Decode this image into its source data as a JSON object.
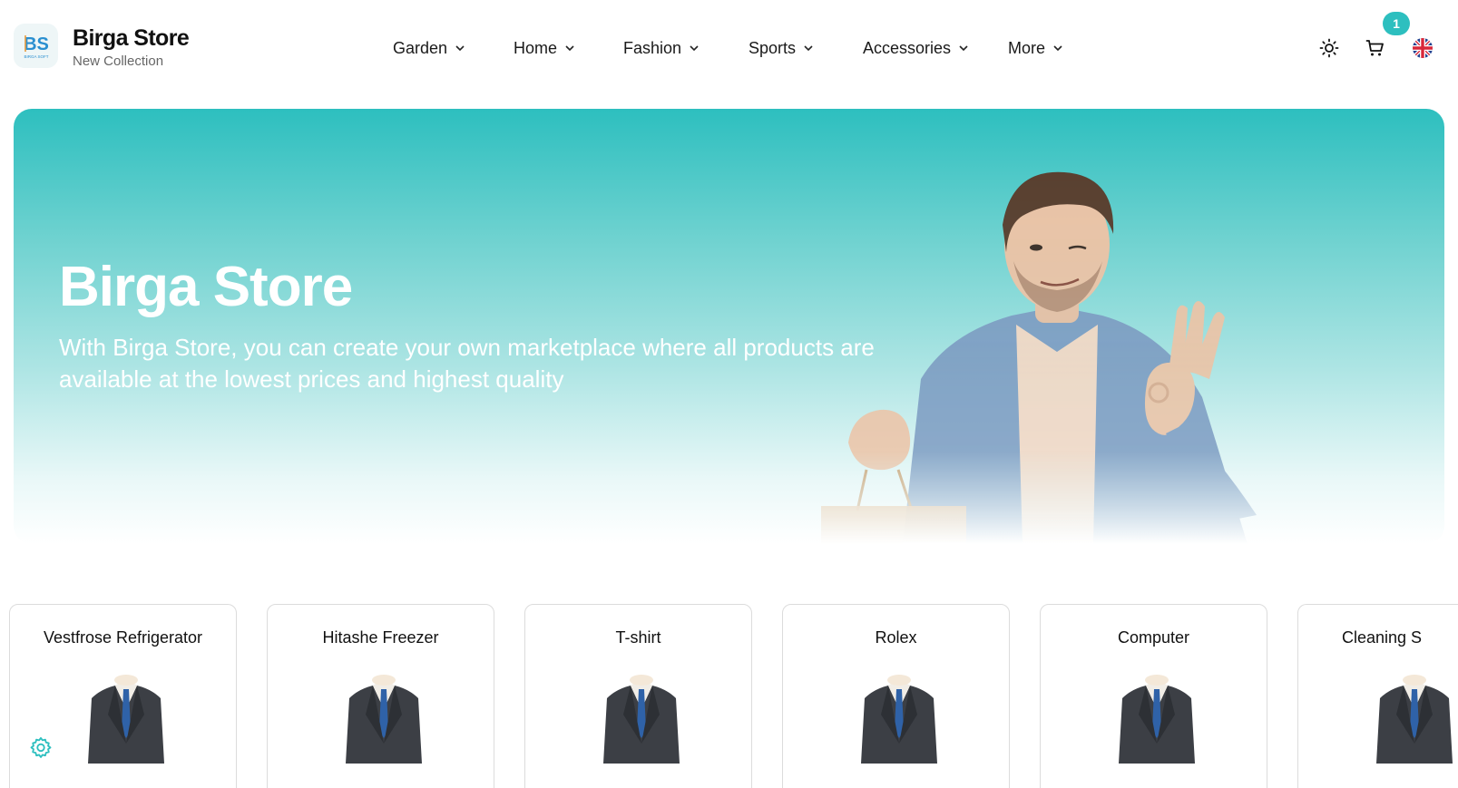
{
  "brand": {
    "title": "Birga Store",
    "subtitle": "New Collection",
    "logo_text": "BS",
    "logo_caption": "BIRGA SOFT"
  },
  "nav": [
    {
      "label": "Garden"
    },
    {
      "label": "Home"
    },
    {
      "label": "Fashion"
    },
    {
      "label": "Sports"
    },
    {
      "label": "Accessories"
    },
    {
      "label": "More"
    }
  ],
  "header_icons": {
    "theme": "sun-icon",
    "cart": "cart-icon",
    "language": "uk-flag-icon"
  },
  "cart_count": "1",
  "hero": {
    "title": "Birga Store",
    "description": "With Birga Store, you can create your own marketplace where all products are available at the lowest prices and highest quality"
  },
  "products": [
    {
      "name": "Vestfrose Refrigerator",
      "icon": "suit-icon"
    },
    {
      "name": "Hitashe Freezer",
      "icon": "suit-icon"
    },
    {
      "name": "T-shirt",
      "icon": "suit-icon"
    },
    {
      "name": "Rolex",
      "icon": "suit-icon"
    },
    {
      "name": "Computer",
      "icon": "suit-icon"
    },
    {
      "name": "Cleaning S",
      "icon": "suit-icon"
    }
  ],
  "colors": {
    "accent": "#2dbfbf",
    "text": "#111111",
    "muted": "#666666"
  }
}
